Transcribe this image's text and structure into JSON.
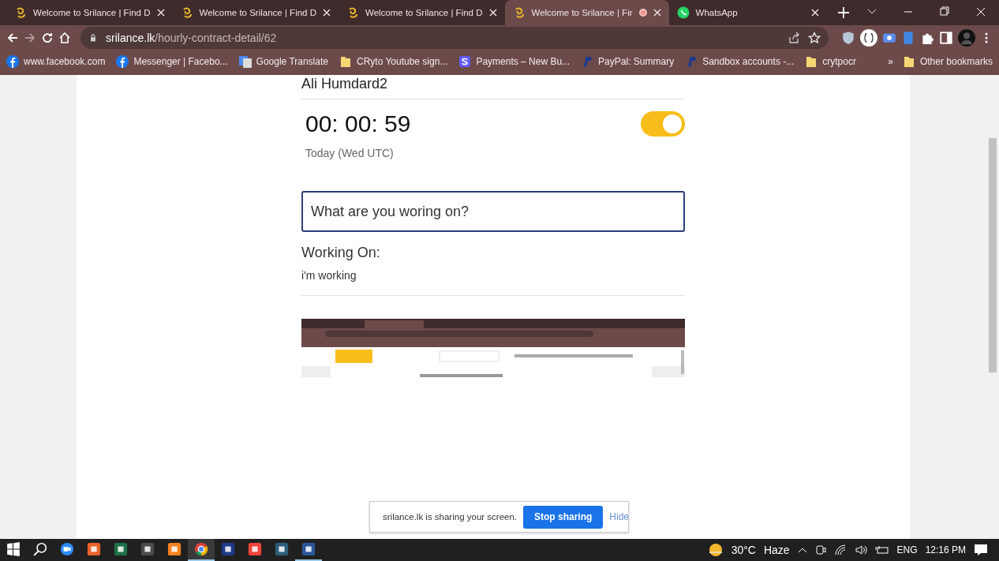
{
  "tabs": [
    {
      "title": "Welcome to Srilance | Find D",
      "kind": "srilance",
      "selected": false,
      "recording": false
    },
    {
      "title": "Welcome to Srilance | Find D",
      "kind": "srilance",
      "selected": false,
      "recording": false
    },
    {
      "title": "Welcome to Srilance | Find D",
      "kind": "srilance",
      "selected": false,
      "recording": false
    },
    {
      "title": "Welcome to Srilance | Fir",
      "kind": "srilance",
      "selected": true,
      "recording": true
    },
    {
      "title": "WhatsApp",
      "kind": "whatsapp",
      "selected": false,
      "recording": false
    }
  ],
  "address": {
    "host": "srilance.lk",
    "path": "/hourly-contract-detail/62"
  },
  "bookmarks": [
    {
      "label": "www.facebook.com",
      "kind": "facebook"
    },
    {
      "label": "Messenger | Facebo...",
      "kind": "facebook"
    },
    {
      "label": "Google Translate",
      "kind": "translate"
    },
    {
      "label": "CRyto Youtube sign...",
      "kind": "folder"
    },
    {
      "label": "Payments – New Bu...",
      "kind": "stripe"
    },
    {
      "label": "PayPal: Summary",
      "kind": "paypal"
    },
    {
      "label": "Sandbox accounts -...",
      "kind": "paypal"
    },
    {
      "label": "crytpocr",
      "kind": "folder"
    }
  ],
  "bookmarks_overflow": "»",
  "other_bookmarks": "Other bookmarks",
  "page": {
    "name": "Ali Humdard2",
    "timer": "00: 00: 59",
    "timer_on": true,
    "date": "Today (Wed UTC)",
    "task_input": {
      "placeholder": "What are you woring on?"
    },
    "working_label": "Working On:",
    "working_text": "i'm working"
  },
  "share_bar": {
    "message": "srilance.lk is sharing your screen.",
    "stop": "Stop sharing",
    "hide": "Hide"
  },
  "taskbar": {
    "apps": [
      {
        "kind": "zoom",
        "selected": false,
        "running": false
      },
      {
        "kind": "recorder",
        "selected": false,
        "running": false
      },
      {
        "kind": "excel",
        "selected": false,
        "running": false
      },
      {
        "kind": "sublime",
        "selected": false,
        "running": false
      },
      {
        "kind": "xampp",
        "selected": false,
        "running": false
      },
      {
        "kind": "chrome",
        "selected": true,
        "running": true
      },
      {
        "kind": "devcpp",
        "selected": false,
        "running": false
      },
      {
        "kind": "anydesk",
        "selected": false,
        "running": false
      },
      {
        "kind": "mysql",
        "selected": false,
        "running": false
      },
      {
        "kind": "word",
        "selected": false,
        "running": true
      }
    ],
    "temperature": "30°C",
    "weather": "Haze",
    "language": "ENG",
    "time": "12:16 PM"
  }
}
